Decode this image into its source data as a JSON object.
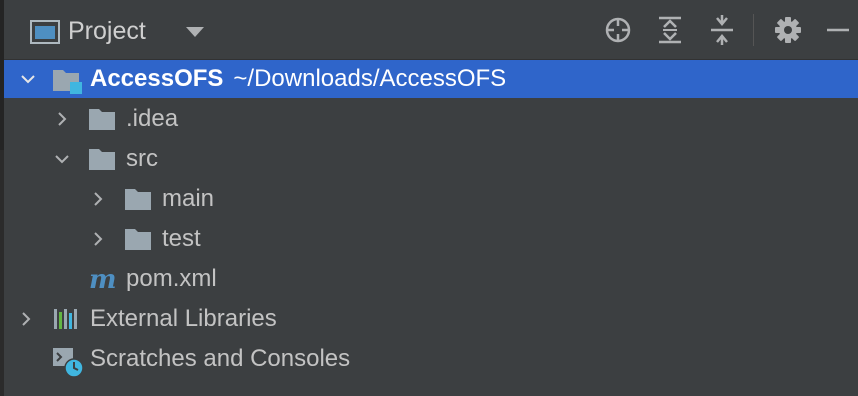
{
  "header": {
    "title": "Project",
    "view_icon": "project-view-icon",
    "dropdown_icon": "chevron-down-icon",
    "toolbar": [
      {
        "name": "locate-icon"
      },
      {
        "name": "expand-all-icon"
      },
      {
        "name": "collapse-all-icon"
      },
      {
        "name": "gear-icon"
      },
      {
        "name": "minimize-icon"
      }
    ]
  },
  "tree": {
    "root": {
      "name": "AccessOFS",
      "path": "~/Downloads/AccessOFS",
      "icon": "module-folder-icon",
      "expanded": true,
      "selected": true
    },
    "items": [
      {
        "label": ".idea",
        "icon": "folder-icon",
        "expanded": false
      },
      {
        "label": "src",
        "icon": "folder-icon",
        "expanded": true
      },
      {
        "label": "main",
        "icon": "folder-icon",
        "expanded": false
      },
      {
        "label": "test",
        "icon": "folder-icon",
        "expanded": false
      },
      {
        "label": "pom.xml",
        "icon": "maven-icon"
      },
      {
        "label": "External Libraries",
        "icon": "libraries-icon",
        "expanded": false
      },
      {
        "label": "Scratches and Consoles",
        "icon": "scratches-icon"
      }
    ]
  },
  "colors": {
    "background": "#3c3f41",
    "selection": "#2f65ca",
    "folder": "#9aa7b0",
    "maven": "#4e8fc2",
    "text": "#c3c3c3"
  }
}
